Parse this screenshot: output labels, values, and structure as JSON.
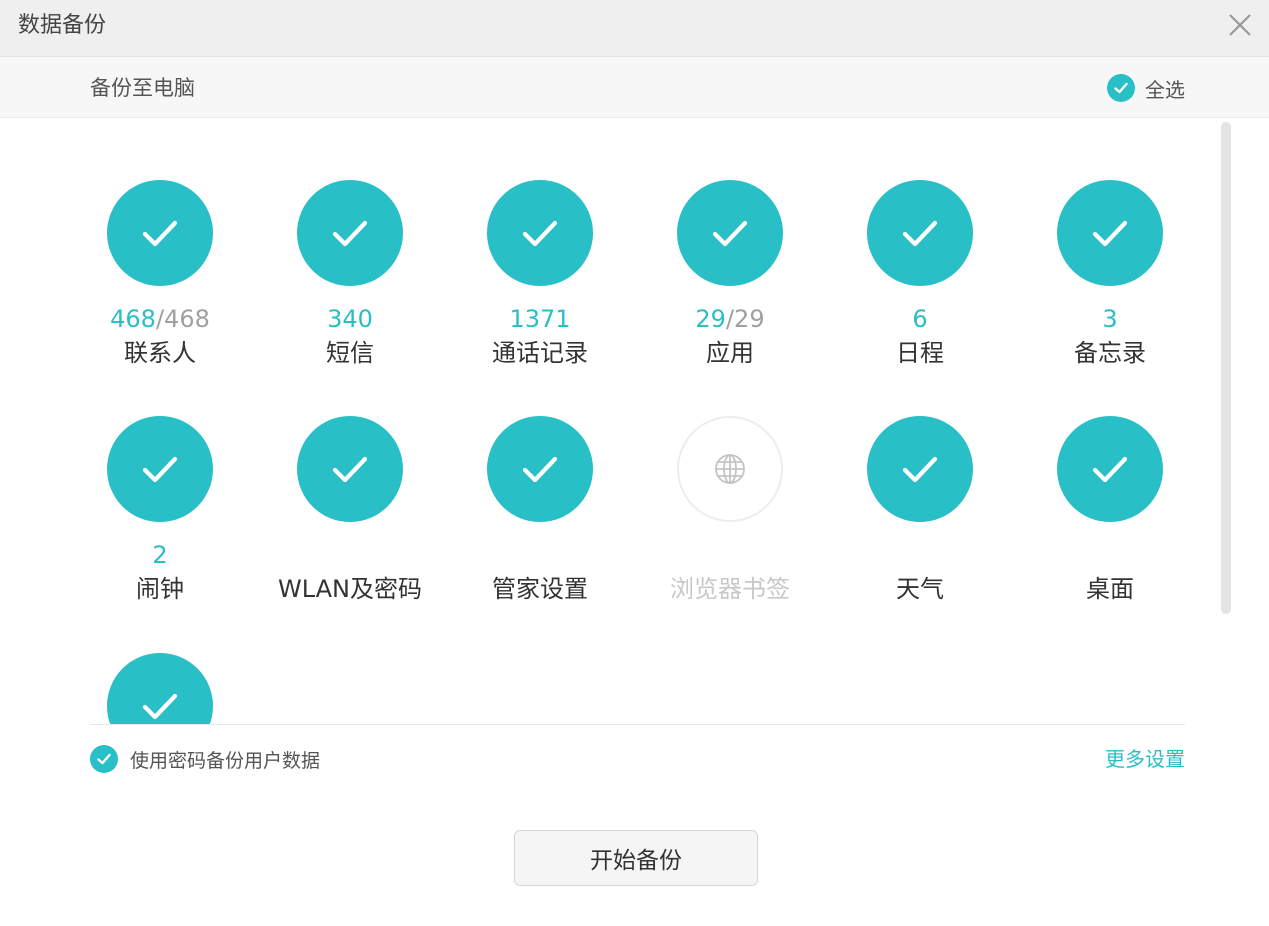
{
  "window": {
    "title": "数据备份"
  },
  "header": {
    "subtitle": "备份至电脑",
    "select_all_label": "全选"
  },
  "colors": {
    "accent": "#28bfc7",
    "inactive": "#c8c8c8"
  },
  "items": [
    {
      "label": "联系人",
      "selected": true,
      "icon": "check-icon",
      "count": "468",
      "count_sep": "/",
      "total": "468"
    },
    {
      "label": "短信",
      "selected": true,
      "icon": "check-icon",
      "count": "340",
      "count_sep": "",
      "total": ""
    },
    {
      "label": "通话记录",
      "selected": true,
      "icon": "check-icon",
      "count": "1371",
      "count_sep": "",
      "total": ""
    },
    {
      "label": "应用",
      "selected": true,
      "icon": "check-icon",
      "count": "29",
      "count_sep": "/",
      "total": "29"
    },
    {
      "label": "日程",
      "selected": true,
      "icon": "check-icon",
      "count": "6",
      "count_sep": "",
      "total": ""
    },
    {
      "label": "备忘录",
      "selected": true,
      "icon": "check-icon",
      "count": "3",
      "count_sep": "",
      "total": ""
    },
    {
      "label": "闹钟",
      "selected": true,
      "icon": "check-icon",
      "count": "2",
      "count_sep": "",
      "total": ""
    },
    {
      "label": "WLAN及密码",
      "selected": true,
      "icon": "check-icon",
      "count": "",
      "count_sep": "",
      "total": ""
    },
    {
      "label": "管家设置",
      "selected": true,
      "icon": "check-icon",
      "count": "",
      "count_sep": "",
      "total": ""
    },
    {
      "label": "浏览器书签",
      "selected": false,
      "icon": "globe-icon",
      "count": "",
      "count_sep": "",
      "total": ""
    },
    {
      "label": "天气",
      "selected": true,
      "icon": "check-icon",
      "count": "",
      "count_sep": "",
      "total": ""
    },
    {
      "label": "桌面",
      "selected": true,
      "icon": "check-icon",
      "count": "",
      "count_sep": "",
      "total": ""
    },
    {
      "label": "",
      "selected": true,
      "icon": "check-icon",
      "count": "",
      "count_sep": "",
      "total": ""
    }
  ],
  "footer": {
    "password_option_label": "使用密码备份用户数据",
    "more_settings_label": "更多设置",
    "start_button_label": "开始备份"
  }
}
